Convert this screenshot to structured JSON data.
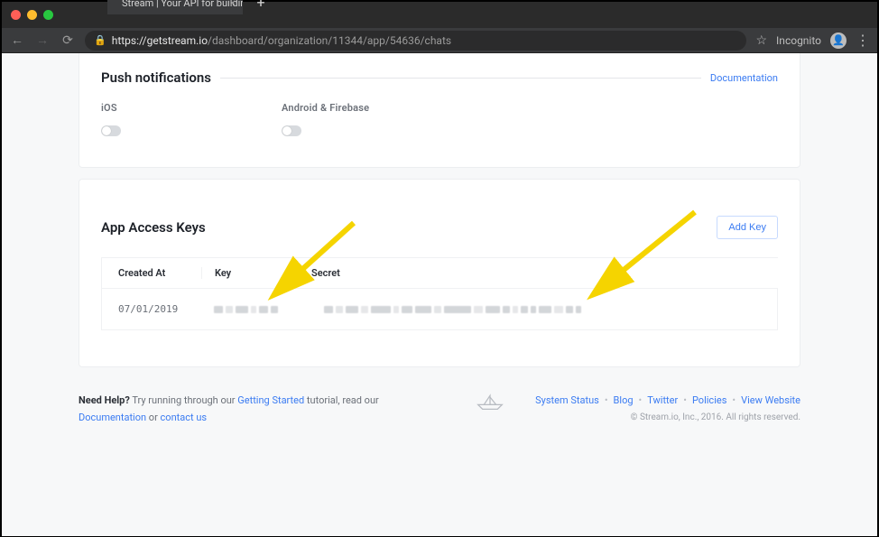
{
  "browser": {
    "tab_title": "Stream | Your API for building",
    "url_host": "https://getstream.io",
    "url_path": "/dashboard/organization/11344/app/54636/chats",
    "incognito_label": "Incognito"
  },
  "push": {
    "section_title": "Push notifications",
    "doc_link": "Documentation",
    "ios_label": "iOS",
    "android_label": "Android & Firebase"
  },
  "access_keys": {
    "title": "App Access Keys",
    "add_key_label": "Add Key",
    "columns": {
      "created": "Created At",
      "key": "Key",
      "secret": "Secret"
    },
    "rows": [
      {
        "created_at": "07/01/2019"
      }
    ]
  },
  "footer": {
    "need_help": "Need Help?",
    "help_text_1": " Try running through our ",
    "getting_started": "Getting Started",
    "help_text_2": " tutorial, read our ",
    "documentation": "Documentation",
    "or": " or ",
    "contact_us": "contact us",
    "links": {
      "status": "System Status",
      "blog": "Blog",
      "twitter": "Twitter",
      "policies": "Policies",
      "view_site": "View Website"
    },
    "copyright": "© Stream.io, Inc., 2016. All rights reserved."
  }
}
